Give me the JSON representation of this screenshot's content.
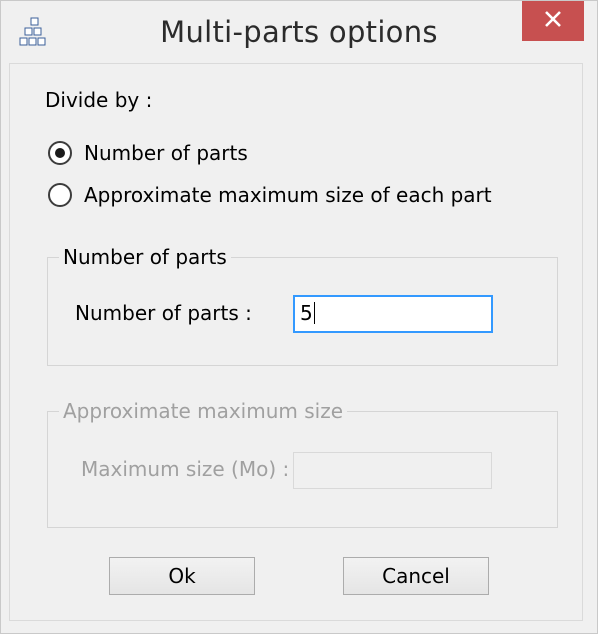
{
  "window": {
    "title": "Multi-parts options",
    "close_label": "Close"
  },
  "divide_by": {
    "label": "Divide by :",
    "options": [
      {
        "label": "Number of parts",
        "selected": true
      },
      {
        "label": "Approximate maximum size of each part",
        "selected": false
      }
    ]
  },
  "parts_group": {
    "title": "Number of parts",
    "field_label": "Number of parts :",
    "field_value": "5"
  },
  "size_group": {
    "title": "Approximate maximum size",
    "field_label": "Maximum size (Mo) :",
    "field_value": "",
    "enabled": false
  },
  "buttons": {
    "ok": "Ok",
    "cancel": "Cancel"
  },
  "colors": {
    "close_button": "#c75050",
    "focus_border": "#3399ff",
    "disabled_text": "#a0a0a0"
  },
  "icons": {
    "app": "app-icon",
    "close": "close-icon"
  }
}
